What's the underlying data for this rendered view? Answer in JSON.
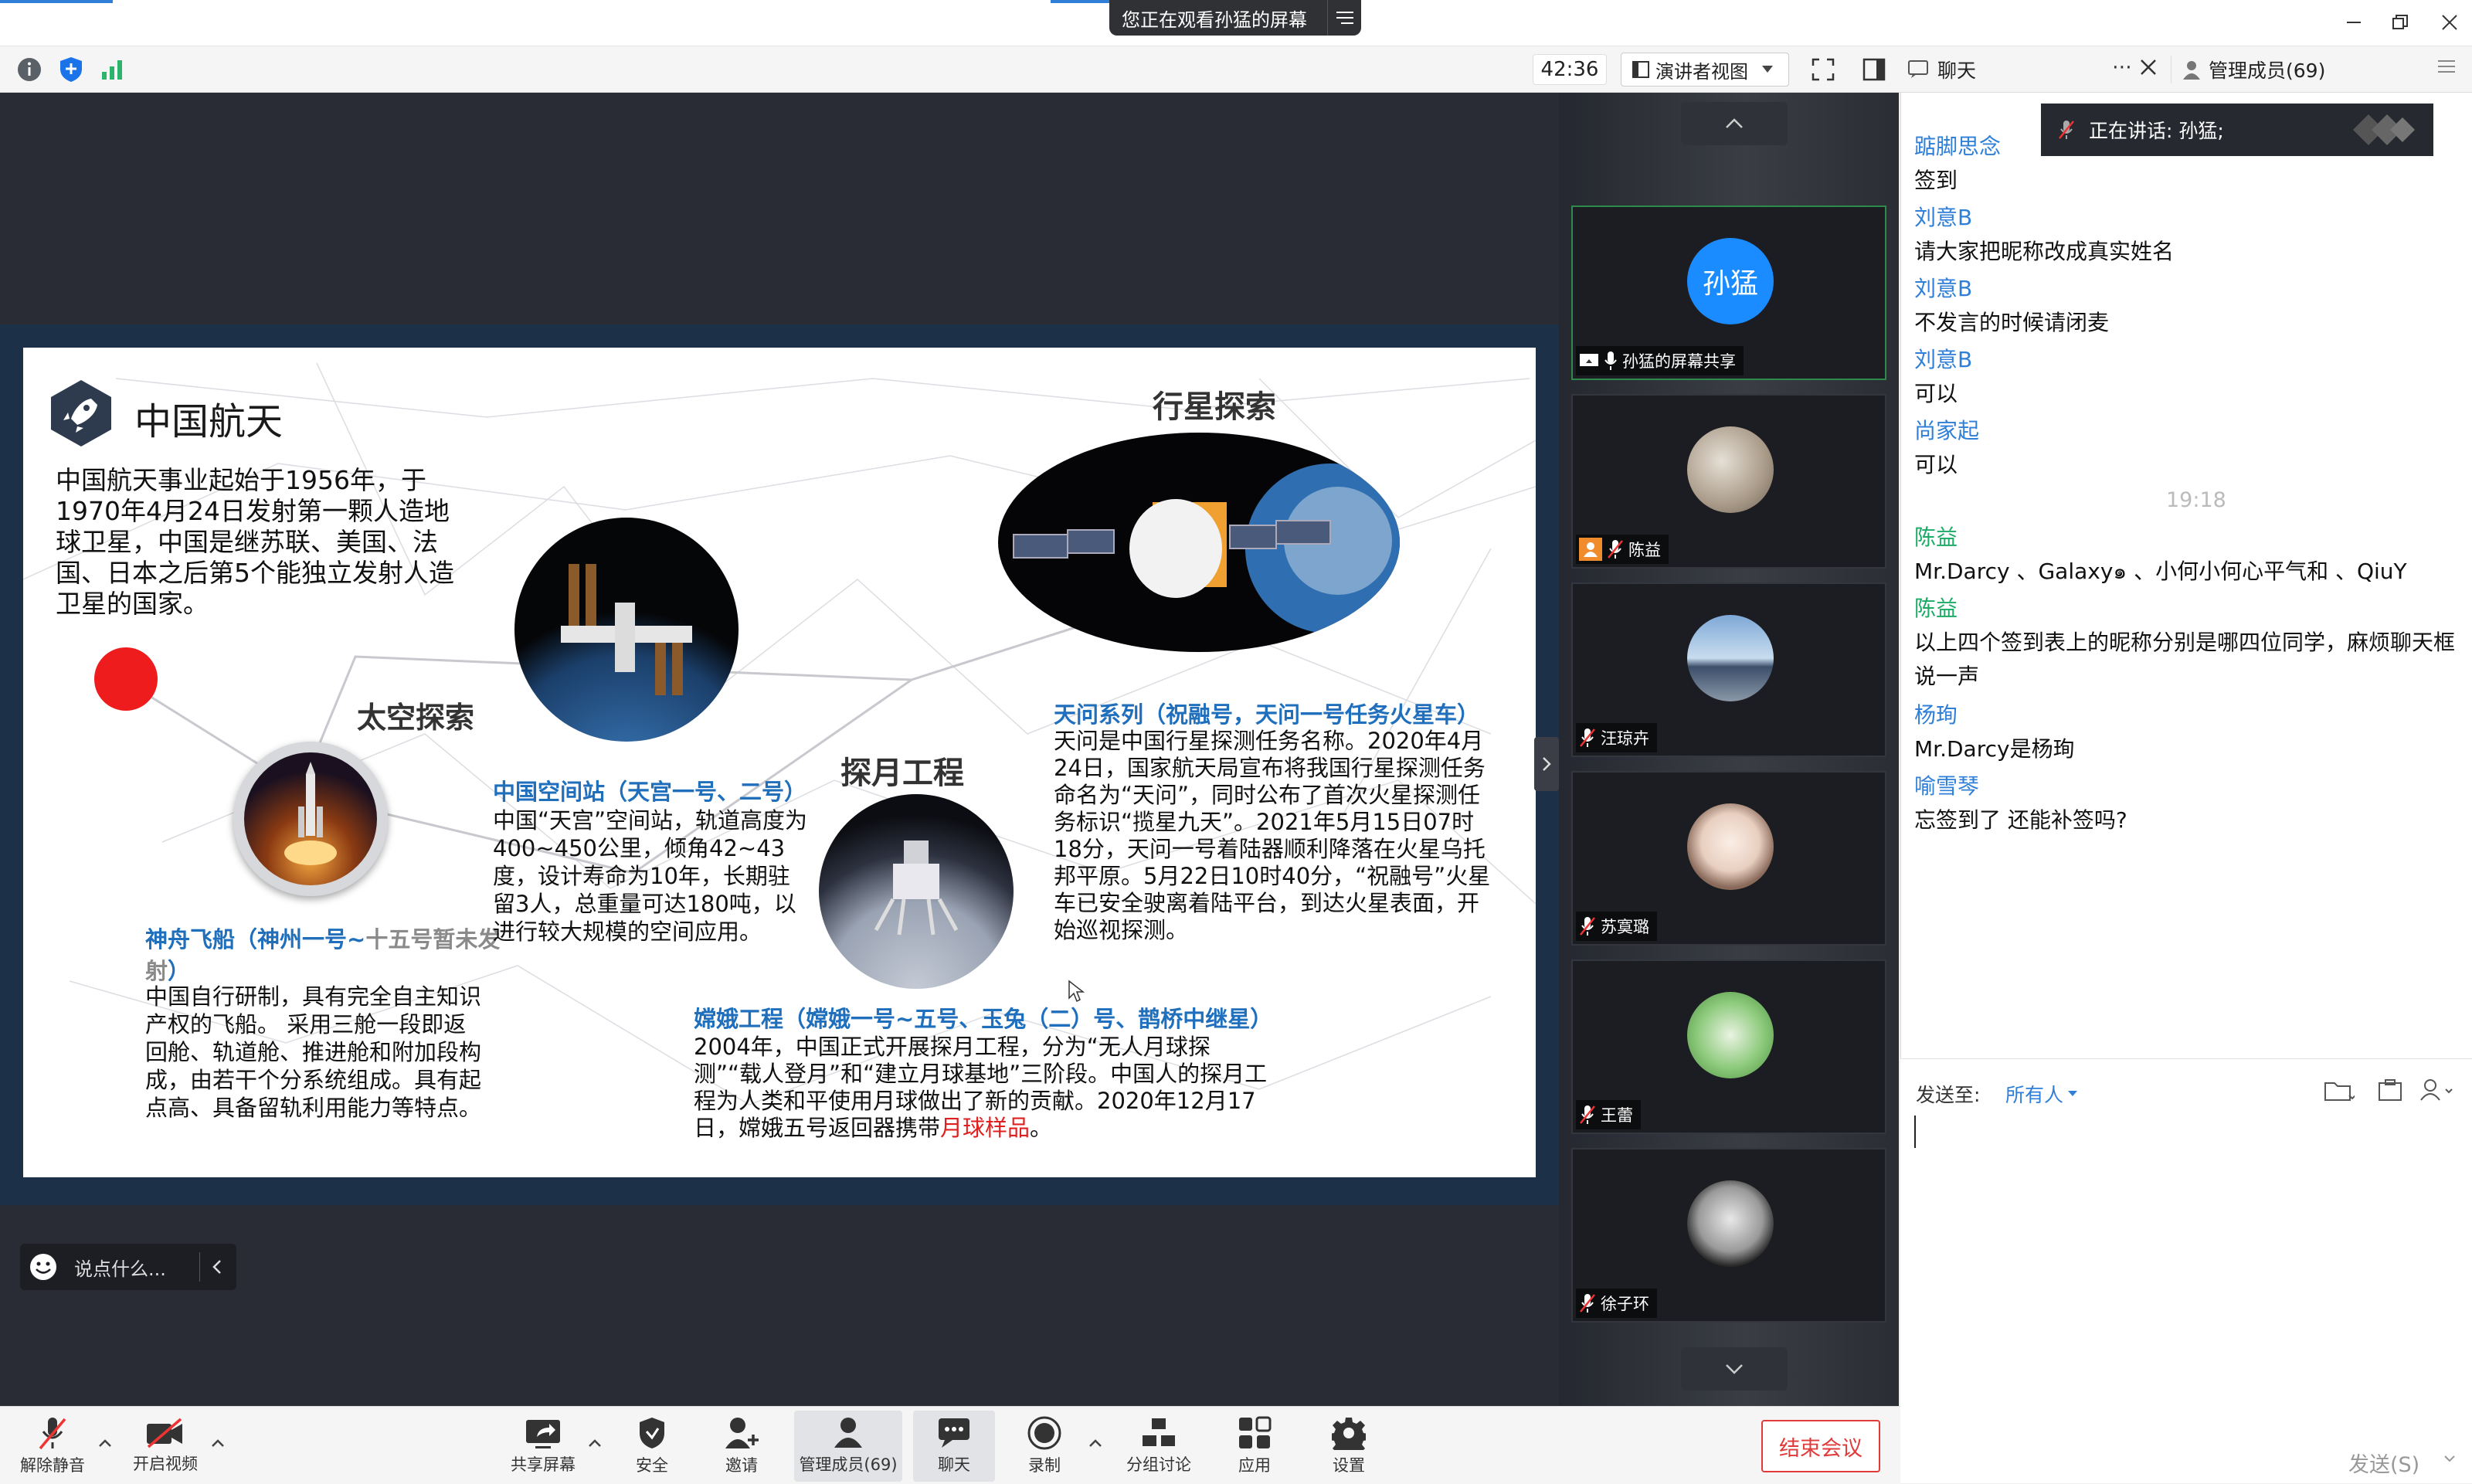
{
  "app": {
    "share_banner": "您正在观看孙猛的屏幕",
    "timer": "42:36",
    "view_mode": "演讲者视图"
  },
  "chat_panel": {
    "tab_chat": "聊天",
    "tab_members": "管理成员(69)",
    "speaking": "正在讲话: 孙猛;",
    "messages": [
      {
        "name": "踮脚思念",
        "text": "签到"
      },
      {
        "name": "刘意B",
        "text": "请大家把昵称改成真实姓名"
      },
      {
        "name": "刘意B",
        "text": "不发言的时候请闭麦"
      },
      {
        "name": "刘意B",
        "text": "可以"
      },
      {
        "name": "尚家起",
        "text": "可以"
      }
    ],
    "time_divider": "19:18",
    "messages2": [
      {
        "name": "陈益",
        "text": "Mr.Darcy 、Galaxy๑ 、小何小何心平气和 、QiuY"
      },
      {
        "name": "陈益",
        "text": "以上四个签到表上的昵称分别是哪四位同学，麻烦聊天框说一声"
      },
      {
        "name": "杨珣",
        "text": "Mr.Darcy是杨珣"
      },
      {
        "name": "喻雪琴",
        "text": "忘签到了 还能补签吗?"
      }
    ],
    "send_to_label": "发送至:",
    "send_to_value": "所有人",
    "send_button": "发送(S)"
  },
  "participants": [
    {
      "name": "孙猛的屏幕共享",
      "avatar_text": "孙猛",
      "active": true
    },
    {
      "name": "陈益"
    },
    {
      "name": "汪琼卉"
    },
    {
      "name": "苏寞璐"
    },
    {
      "name": "王蕾"
    },
    {
      "name": "徐子环"
    }
  ],
  "slide": {
    "brand": "中国航天",
    "intro": "中国航天事业起始于1956年，于1970年4月24日发射第一颗人造地球卫星，中国是继苏联、美国、法国、日本之后第5个能独立发射人造卫星的国家。",
    "space_explore": "太空探索",
    "planet_explore": "行星探索",
    "moon_project": "探月工程",
    "shenzhou_title": "神舟飞船（神州一号~",
    "shenzhou_grey": "十五号暂未发射",
    "shenzhou_title_end": "）",
    "shenzhou_body": "中国自行研制，具有完全自主知识产权的飞船。 采用三舱一段即返回舱、轨道舱、推进舱和附加段构成，由若干个分系统组成。具有起点高、具备留轨利用能力等特点。",
    "station_title": "中国空间站（天宫一号、二号）",
    "station_body": "中国“天宫”空间站，轨道高度为400~450公里，倾角42~43度，设计寿命为10年，长期驻留3人，总重量可达180吨，以进行较大规模的空间应用。",
    "tianwen_title": "天问系列（祝融号，天问一号任务火星车）",
    "tianwen_body": "天问是中国行星探测任务名称。2020年4月24日，国家航天局宣布将我国行星探测任务命名为“天问”，同时公布了首次火星探测任务标识“揽星九天”。2021年5月15日07时18分，天问一号着陆器顺利降落在火星乌托邦平原。5月22日10时40分，“祝融号”火星车已安全驶离着陆平台，到达火星表面，开始巡视探测。",
    "change_title": "嫦娥工程（嫦娥一号~五号、玉兔（二）号、鹊桥中继星）",
    "change_body": "2004年，中国正式开展探月工程，分为“无人月球探测”“载人登月”和“建立月球基地”三阶段。中国人的探月工程为人类和平使用月球做出了新的贡献。2020年12月17日，嫦娥五号返回器携带",
    "change_red": "月球样品",
    "change_end": "。"
  },
  "chat_input": {
    "placeholder": "说点什么..."
  },
  "bottom_toolbar": {
    "unmute": "解除静音",
    "video": "开启视频",
    "share": "共享屏幕",
    "security": "安全",
    "invite": "邀请",
    "members": "管理成员(69)",
    "chat": "聊天",
    "record": "录制",
    "breakout": "分组讨论",
    "apps": "应用",
    "settings": "设置",
    "end": "结束会议"
  }
}
